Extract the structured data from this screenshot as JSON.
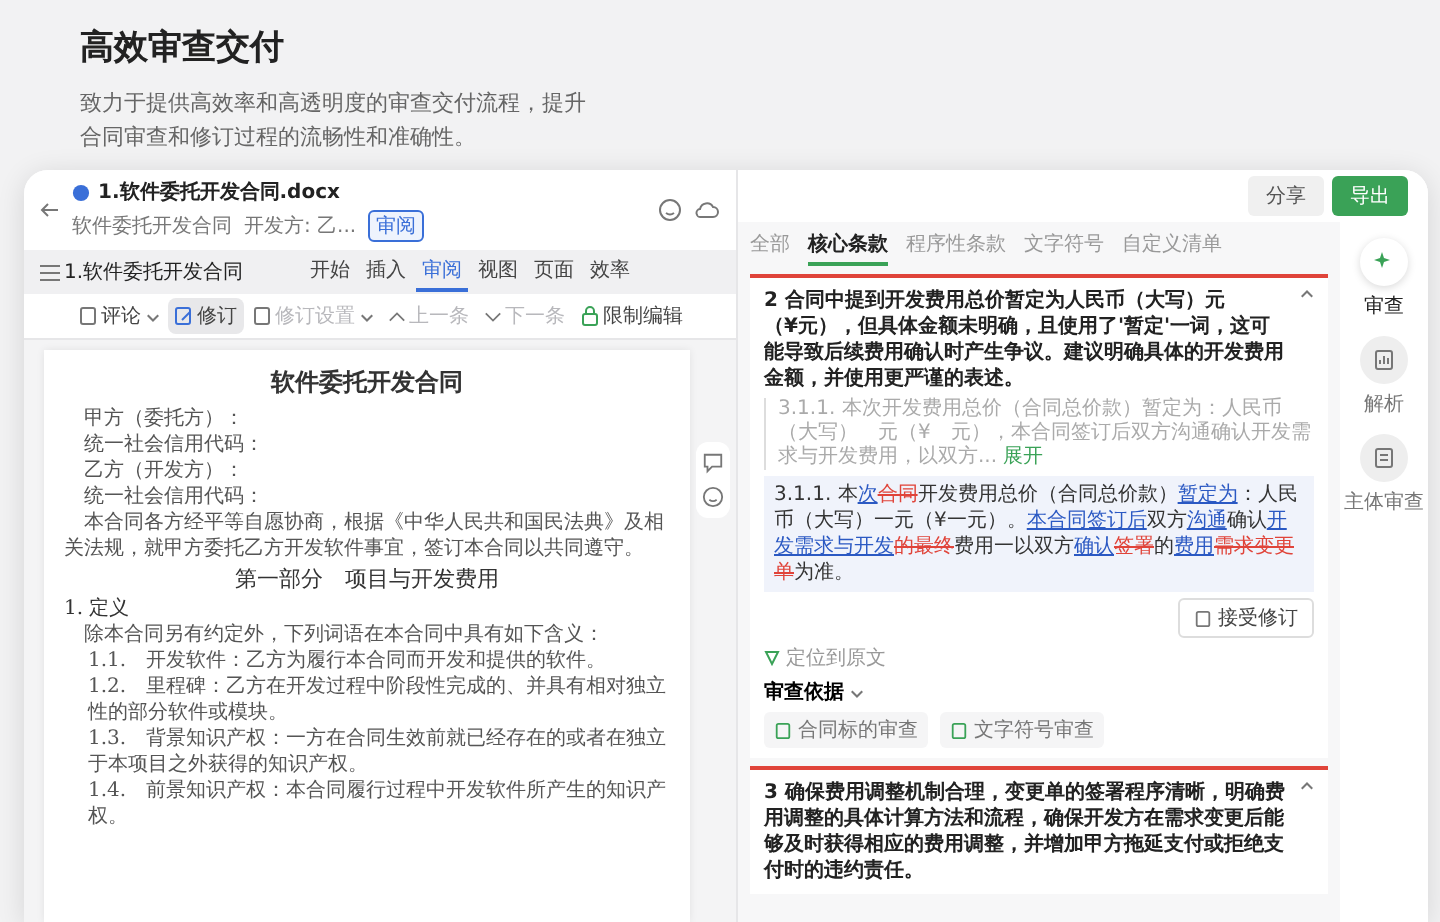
{
  "hero": {
    "title": "高效审查交付",
    "description": "致力于提供高效率和高透明度的审查交付流程，提升合同审查和修订过程的流畅性和准确性。"
  },
  "window": {
    "actions": [
      {
        "label": "分享",
        "kind": "secondary"
      },
      {
        "label": "导出",
        "kind": "primary"
      }
    ],
    "document_header": {
      "filename": "1.软件委托开发合同.docx",
      "subtitle": "软件委托开发合同",
      "party": "开发方: 乙...",
      "badge": "审阅"
    },
    "ribbon": {
      "doc_title": "1.软件委托开发合同",
      "tabs": [
        {
          "label": "开始",
          "selected": false
        },
        {
          "label": "插入",
          "selected": false
        },
        {
          "label": "审阅",
          "selected": true
        },
        {
          "label": "视图",
          "selected": false
        },
        {
          "label": "页面",
          "selected": false
        },
        {
          "label": "效率",
          "selected": false
        }
      ]
    },
    "toolbar": [
      {
        "label": "评论",
        "kind": "dropdown",
        "on": false,
        "disabled": false
      },
      {
        "label": "修订",
        "kind": "toggle",
        "on": true,
        "disabled": false
      },
      {
        "label": "修订设置",
        "kind": "dropdown",
        "on": false,
        "disabled": true
      },
      {
        "label": "上一条",
        "kind": "prev",
        "on": false,
        "disabled": true
      },
      {
        "label": "下一条",
        "kind": "next",
        "on": false,
        "disabled": true
      },
      {
        "label": "限制编辑",
        "kind": "lock",
        "on": false,
        "disabled": false
      }
    ],
    "document": {
      "title": "软件委托开发合同",
      "paragraphs": [
        {
          "kind": "party",
          "text": "甲方（委托方）："
        },
        {
          "kind": "party",
          "text": "统一社会信用代码："
        },
        {
          "kind": "party",
          "text": "乙方（开发方）："
        },
        {
          "kind": "party",
          "text": "统一社会信用代码："
        },
        {
          "kind": "body",
          "text": "本合同各方经平等自愿协商，根据《中华人民共和国民法典》及相关法规，就甲方委托乙方开发软件事宜，签订本合同以共同遵守。"
        },
        {
          "kind": "section",
          "text": "第一部分　项目与开发费用"
        },
        {
          "kind": "heading",
          "text": "1. 定义"
        },
        {
          "kind": "body",
          "text": "除本合同另有约定外，下列词语在本合同中具有如下含义："
        },
        {
          "kind": "clause",
          "text": "1.1.　开发软件：乙方为履行本合同而开发和提供的软件。"
        },
        {
          "kind": "clause",
          "text": "1.2.　里程碑：乙方在开发过程中阶段性完成的、并具有相对独立性的部分软件或模块。"
        },
        {
          "kind": "clause",
          "text": "1.3.　背景知识产权：一方在合同生效前就已经存在的或者在独立于本项目之外获得的知识产权。"
        },
        {
          "kind": "clause",
          "text": "1.4.　前景知识产权：本合同履行过程中开发软件所产生的知识产权。"
        }
      ]
    },
    "review_panel": {
      "tabs": [
        {
          "label": "全部",
          "selected": false
        },
        {
          "label": "核心条款",
          "selected": true
        },
        {
          "label": "程序性条款",
          "selected": false
        },
        {
          "label": "文字符号",
          "selected": false
        },
        {
          "label": "自定义清单",
          "selected": false
        }
      ],
      "cards": [
        {
          "title": "2 合同中提到开发费用总价暂定为人民币（大写）元（¥元），但具体金额未明确，且使用了'暂定'一词，这可能导致后续费用确认时产生争议。建议明确具体的开发费用金额，并使用更严谨的表述。",
          "original": "3.1.1. 本次开发费用总价（合同总价款）暂定为：人民币（大写）　元（¥　元），本合同签订后双方沟通确认开发需求与开发费用，以双方...",
          "expand_link": "展开",
          "revision": [
            {
              "kind": "plain",
              "text": "3.1.1. 本"
            },
            {
              "kind": "added",
              "text": "次"
            },
            {
              "kind": "removed",
              "text": "合同"
            },
            {
              "kind": "plain",
              "text": "开发费用总价（合同总价款）"
            },
            {
              "kind": "added",
              "text": "暂定为"
            },
            {
              "kind": "plain",
              "text": "：人民币（大写）一元（¥一元）。"
            },
            {
              "kind": "added",
              "text": "本合同签订后"
            },
            {
              "kind": "plain",
              "text": "双方"
            },
            {
              "kind": "added",
              "text": "沟通"
            },
            {
              "kind": "plain",
              "text": "确认"
            },
            {
              "kind": "added",
              "text": "开发需求与开发"
            },
            {
              "kind": "removed",
              "text": "的最终"
            },
            {
              "kind": "plain",
              "text": "费用一以双方"
            },
            {
              "kind": "added",
              "text": "确认"
            },
            {
              "kind": "removed",
              "text": "签署"
            },
            {
              "kind": "plain",
              "text": "的"
            },
            {
              "kind": "added",
              "text": "费用"
            },
            {
              "kind": "removed",
              "text": "需求变更单"
            },
            {
              "kind": "plain",
              "text": "为准。"
            }
          ],
          "accept_label": "接受修订",
          "locate_label": "定位到原文",
          "basis_label": "审查依据",
          "basis_chips": [
            "合同标的审查",
            "文字符号审查"
          ]
        },
        {
          "title": "3 确保费用调整机制合理，变更单的签署程序清晰，明确费用调整的具体计算方法和流程，确保开发方在需求变更后能够及时获得相应的费用调整，并增加甲方拖延支付或拒绝支付时的违约责任。"
        }
      ]
    },
    "rail": [
      {
        "label": "审查",
        "selected": true
      },
      {
        "label": "解析",
        "selected": false
      },
      {
        "label": "主体审查",
        "selected": false
      }
    ]
  }
}
